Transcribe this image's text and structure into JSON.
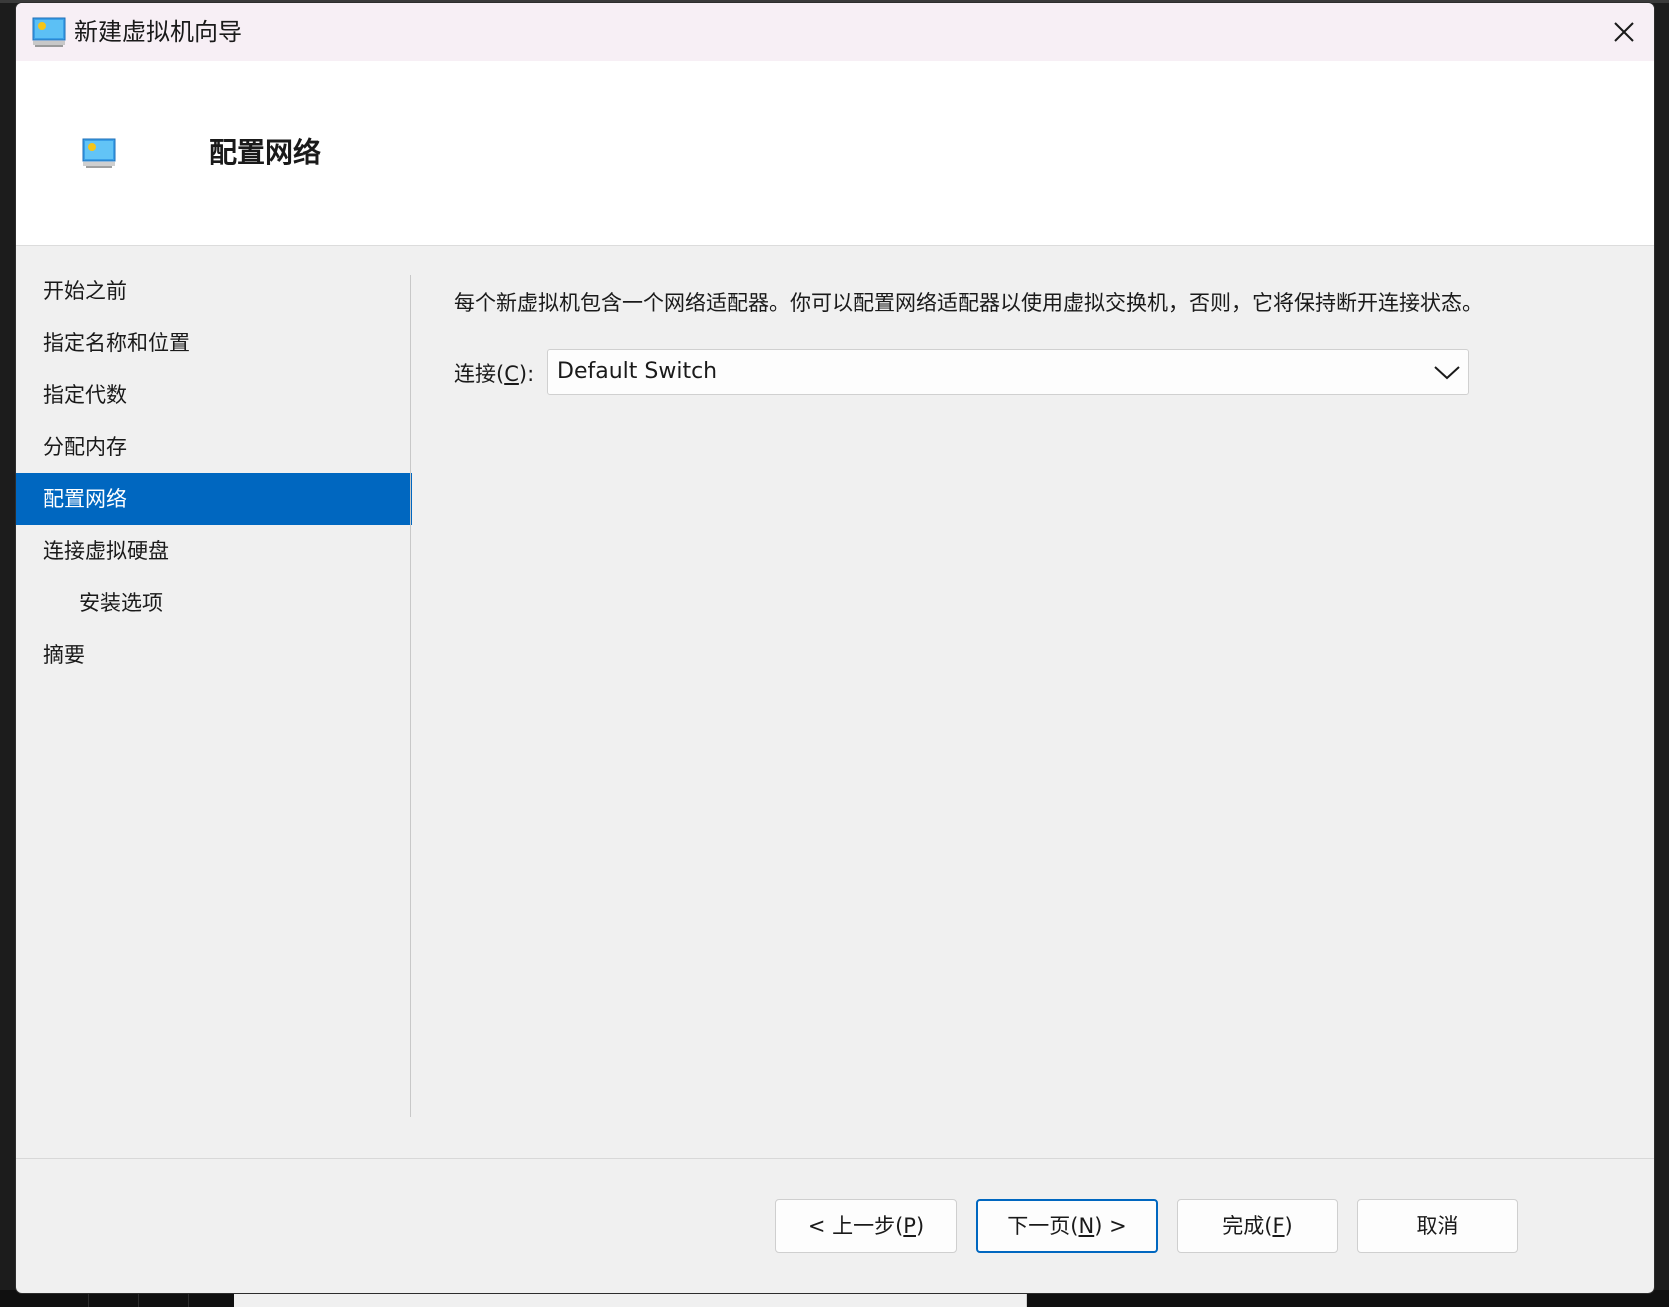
{
  "window": {
    "title": "新建虚拟机向导",
    "close_symbol": "✕"
  },
  "header": {
    "title": "配置网络"
  },
  "nav": {
    "items": [
      {
        "label": "开始之前",
        "active": false,
        "sub": false
      },
      {
        "label": "指定名称和位置",
        "active": false,
        "sub": false
      },
      {
        "label": "指定代数",
        "active": false,
        "sub": false
      },
      {
        "label": "分配内存",
        "active": false,
        "sub": false
      },
      {
        "label": "配置网络",
        "active": true,
        "sub": false
      },
      {
        "label": "连接虚拟硬盘",
        "active": false,
        "sub": false
      },
      {
        "label": "安装选项",
        "active": false,
        "sub": true
      },
      {
        "label": "摘要",
        "active": false,
        "sub": false
      }
    ]
  },
  "content": {
    "description": "每个新虚拟机包含一个网络适配器。你可以配置网络适配器以使用虚拟交换机，否则，它将保持断开连接状态。",
    "connection": {
      "label_prefix": "连接(",
      "label_key": "C",
      "label_suffix": "):",
      "selected": "Default Switch"
    }
  },
  "footer": {
    "back": {
      "prefix": "< 上一步(",
      "key": "P",
      "suffix": ")"
    },
    "next": {
      "prefix": "下一页(",
      "key": "N",
      "suffix": ") >"
    },
    "finish": {
      "prefix": "完成(",
      "key": "F",
      "suffix": ")"
    },
    "cancel": {
      "label": "取消"
    }
  },
  "colors": {
    "accent": "#0067c0",
    "titlebar": "#f7eff5",
    "content_bg": "#f0f0f0"
  },
  "icons": {
    "title": "hyperv-vm-icon",
    "header": "hyperv-vm-icon",
    "close": "close-icon",
    "dropdown": "chevron-down-icon"
  }
}
